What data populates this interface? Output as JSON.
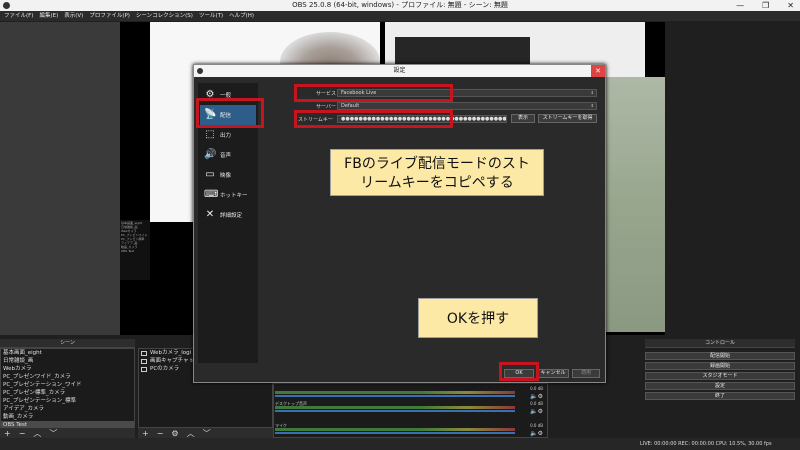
{
  "window": {
    "title": "OBS 25.0.8 (64-bit, windows) - プロファイル: 無題 - シーン: 無題",
    "controls": [
      "—",
      "❐",
      "✕"
    ]
  },
  "menu": [
    "ファイル(F)",
    "編集(E)",
    "表示(V)",
    "プロファイル(P)",
    "シーンコレクション(S)",
    "ツール(T)",
    "ヘルプ(H)"
  ],
  "preview": {
    "mini_list": [
      "基本画面_eight",
      "日常雑談_画",
      "Webカメラ",
      "PC_プレゼンワイド",
      "PC_プレゼン標準",
      "アイデア_画",
      "動画_カメラ",
      "OBS Test"
    ]
  },
  "scenes": {
    "header": "シーン",
    "items": [
      "基本画面_eight",
      "日常雑談_画",
      "Webカメラ",
      "PC_プレゼンワイド_カメラ",
      "PC_プレゼンテーション_ワイド",
      "PC_プレゼン標準_カメラ",
      "PC_プレゼンテーション_標準",
      "アイデア_カメラ",
      "動画_カメラ",
      "OBS Test"
    ],
    "selected_index": 9
  },
  "sources": {
    "items": [
      "Webカメラ_logi",
      "画面キャプチャ test",
      "PCのカメラ"
    ]
  },
  "mixer": {
    "tracks": [
      {
        "name": "",
        "db": "0.0 dB"
      },
      {
        "name": "デスクトップ音声",
        "db": "0.0 dB"
      },
      {
        "name": "マイク",
        "db": "0.0 dB"
      }
    ]
  },
  "controls": {
    "header": "コントロール",
    "buttons": [
      "配信開始",
      "録画開始",
      "スタジオモード",
      "設定",
      "終了"
    ]
  },
  "status": {
    "text": "LIVE: 00:00:00   REC: 00:00:00   CPU: 10.5%, 30.00 fps"
  },
  "settings": {
    "title": "設定",
    "close": "✕",
    "nav": [
      {
        "label": "一般",
        "icon": "⚙"
      },
      {
        "label": "配信",
        "icon": "📡"
      },
      {
        "label": "出力",
        "icon": "⬚"
      },
      {
        "label": "音声",
        "icon": "🔊"
      },
      {
        "label": "映像",
        "icon": "▭"
      },
      {
        "label": "ホットキー",
        "icon": "⌨"
      },
      {
        "label": "詳細設定",
        "icon": "✕"
      }
    ],
    "active_nav": 1,
    "service_label": "サービス",
    "service_value": "Facebook Live",
    "server_label": "サーバー",
    "server_value": "Default",
    "stream_key_label": "ストリームキー",
    "stream_key_value": "●●●●●●●●●●●●●●●●●●●●●●●●●●●●●●●●●●●●●●●●●●●",
    "show_button": "表示",
    "get_key_button": "ストリームキーを取得",
    "ok_button": "OK",
    "cancel_button": "キャンセル",
    "apply_button": "適用"
  },
  "annotations": {
    "stream_key_note_line1": "FBのライブ配信モードのスト",
    "stream_key_note_line2": "リームキーをコピペする",
    "ok_note": "OKを押す"
  }
}
